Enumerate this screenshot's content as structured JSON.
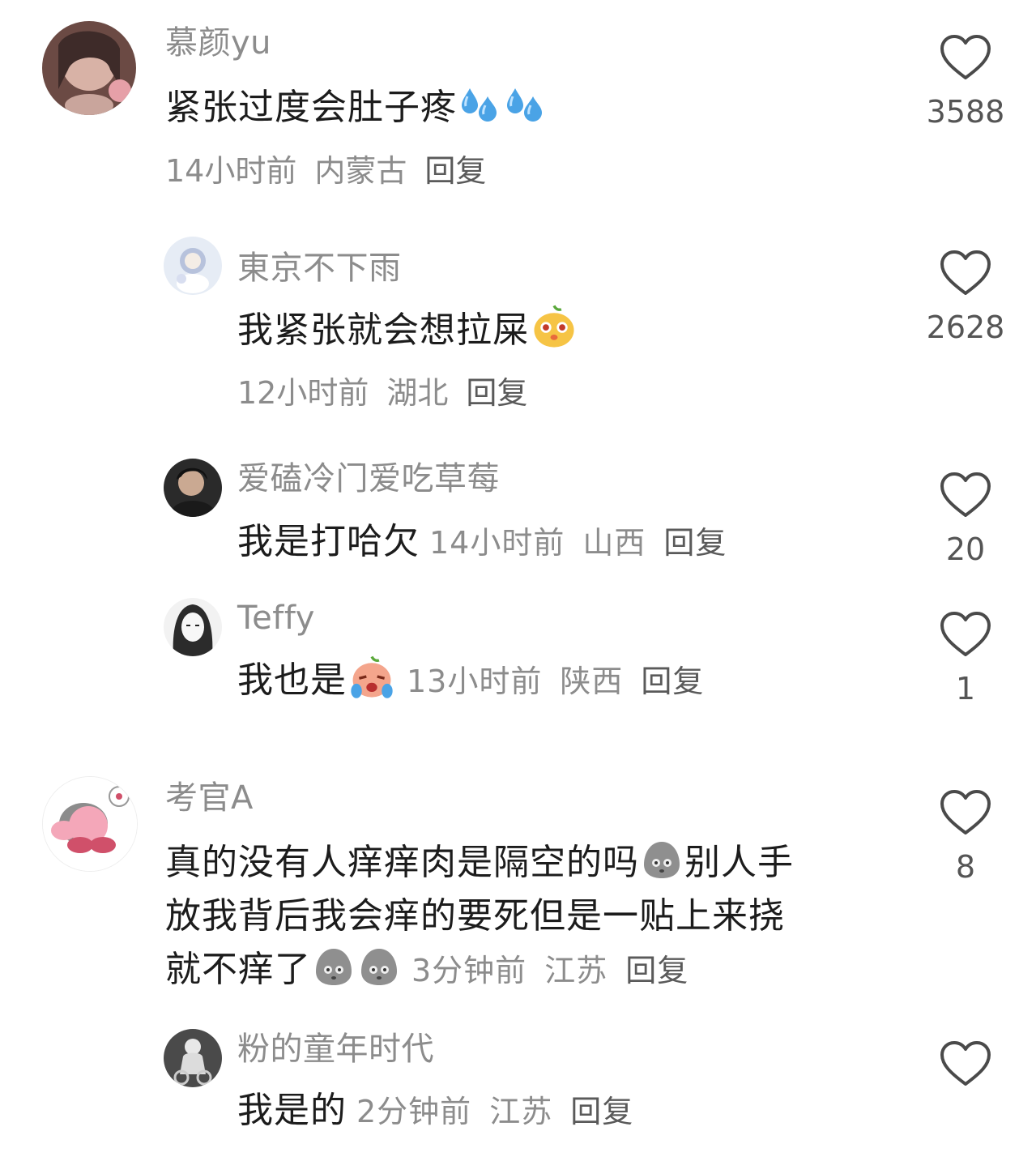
{
  "comments": [
    {
      "username": "慕颜yu",
      "text": "紧张过度会肚子疼",
      "time": "14小时前",
      "location": "内蒙古",
      "reply": "回复",
      "likes": "3588"
    },
    {
      "username": "東京不下雨",
      "text": "我紧张就会想拉屎",
      "time": "12小时前",
      "location": "湖北",
      "reply": "回复",
      "likes": "2628"
    },
    {
      "username": "爱磕冷门爱吃草莓",
      "text": "我是打哈欠",
      "time": "14小时前",
      "location": "山西",
      "reply": "回复",
      "likes": "20"
    },
    {
      "username": "Teffy",
      "text": "我也是",
      "time": "13小时前",
      "location": "陕西",
      "reply": "回复",
      "likes": "1"
    },
    {
      "username": "考官A",
      "text_line1a": "真的没有人痒痒肉是隔空的吗",
      "text_line1b": "别人手",
      "text_line2": "放我背后我会痒的要死但是一贴上来挠",
      "text_line3": "就不痒了",
      "time": "3分钟前",
      "location": "江苏",
      "reply": "回复",
      "likes": "8"
    },
    {
      "username": "粉的童年时代",
      "text": "我是的",
      "time": "2分钟前",
      "location": "江苏",
      "reply": "回复",
      "likes": ""
    }
  ],
  "icons": {
    "like": "heart-outline-icon",
    "sweat": "sweat-droplets-emoji",
    "dog": "smiling-dog-emoji",
    "cry": "crying-face-emoji",
    "blank": "gray-blank-face-emoji"
  },
  "colors": {
    "username": "#8c8c8c",
    "text": "#1c1c1c",
    "meta": "#8c8c8c"
  }
}
